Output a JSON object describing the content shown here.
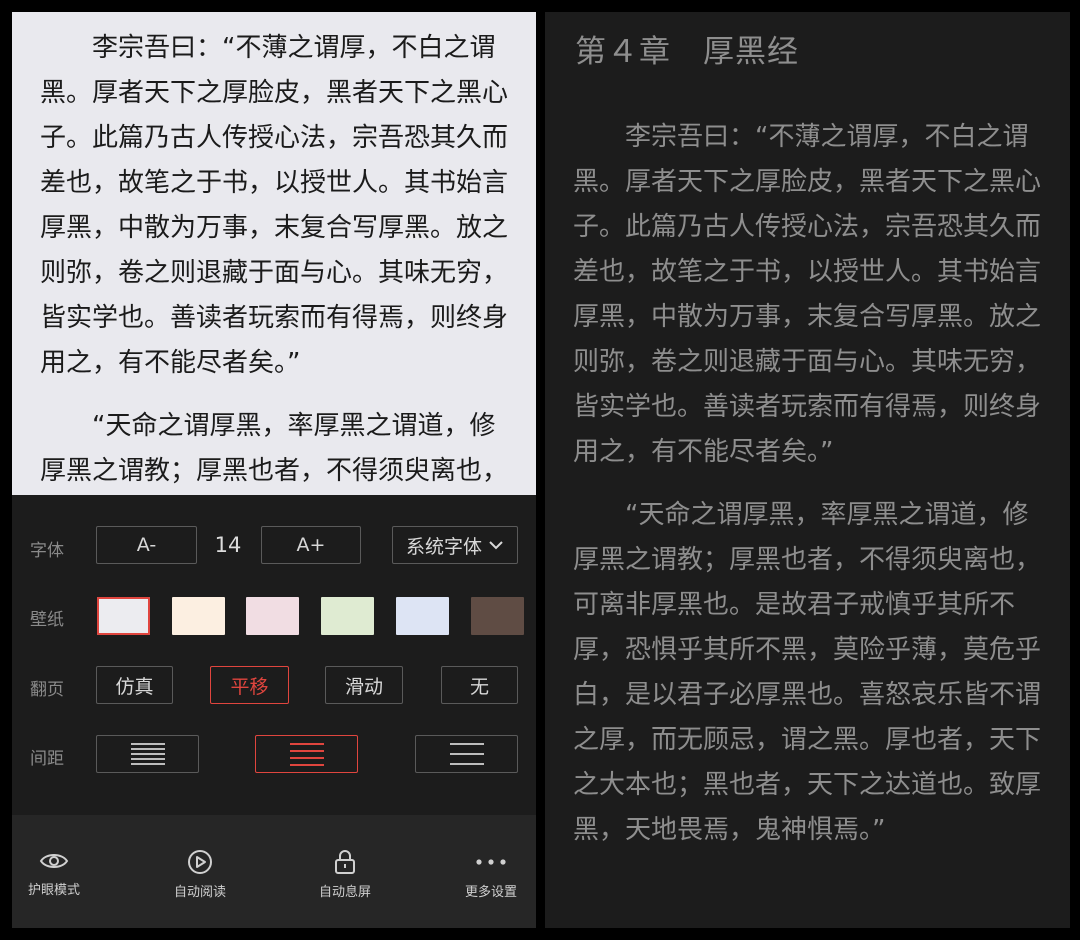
{
  "reader": {
    "chapter_title": "第４章　厚黑经",
    "para1": "李宗吾曰：“不薄之谓厚，不白之谓黑。厚者天下之厚脸皮，黑者天下之黑心子。此篇乃古人传授心法，宗吾恐其久而差也，故笔之于书，以授世人。其书始言厚黑，中散为万事，末复合写厚黑。放之则弥，卷之则退藏于面与心。其味无穷，皆实学也。善读者玩索而有得焉，则终身用之，有不能尽者矣。”",
    "para2": "“天命之谓厚黑，率厚黑之谓道，修厚黑之谓教；厚黑也者，不得须臾离也，可离非厚黑也。是故君子戒慎乎其所不厚，恐惧乎其所不黑，莫险乎薄，莫危乎白，是以君子必厚黑也。喜怒哀乐皆不谓之厚，而无顾忌，谓之黑。厚也者，天下之大本也；黑也者，天下之达道也。致厚黑，天地畏焉，鬼神惧焉。”"
  },
  "settings": {
    "font": {
      "label": "字体",
      "decrease": "A-",
      "size": "14",
      "increase": "A+",
      "family": "系统字体"
    },
    "wallpaper": {
      "label": "壁纸",
      "swatches": [
        "#ececf0",
        "#fcefe1",
        "#f1dde3",
        "#dfebd2",
        "#dde4f4",
        "#5f4c44"
      ],
      "selected_index": 0
    },
    "page_turn": {
      "label": "翻页",
      "options": [
        "仿真",
        "平移",
        "滑动",
        "无"
      ],
      "selected": "平移"
    },
    "spacing": {
      "label": "间距",
      "selected_index": 1
    },
    "accent_color": "#e0453e"
  },
  "bottom_bar": {
    "eye_care": "护眼模式",
    "auto_read": "自动阅读",
    "auto_lock": "自动息屏",
    "more": "更多设置"
  }
}
